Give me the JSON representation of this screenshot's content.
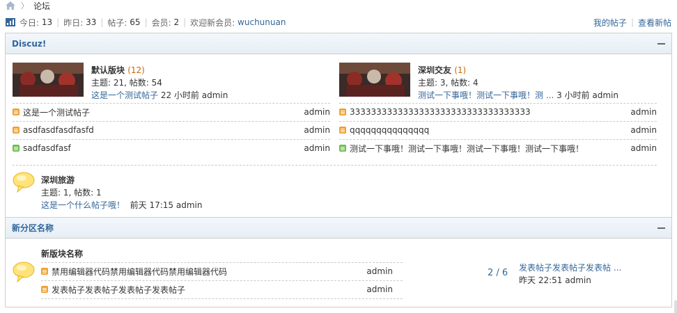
{
  "breadcrumb": {
    "icon": "home-icon",
    "separator": "〉",
    "current": "论坛"
  },
  "stats": {
    "today_label": "今日:",
    "today": "13",
    "yesterday_label": "昨日:",
    "yesterday": "33",
    "posts_label": "帖子:",
    "posts": "65",
    "members_label": "会员:",
    "members": "2",
    "newmember_label": "欢迎新会员:",
    "newmember": "wuchunuan"
  },
  "toplinks": {
    "my_posts": "我的帖子",
    "new_posts": "查看新帖"
  },
  "colors": {
    "link": "#336699",
    "orange_icon": "#f0a030",
    "green_icon": "#6bbf4a",
    "count": "#cc6600"
  },
  "sections": [
    {
      "title": "Discuz!",
      "forums": [
        {
          "name": "默认版块",
          "count": "(12)",
          "stats": "主题: 21, 帖数: 54",
          "last_title": "这是一个测试帖子",
          "last_time": "22 小时前",
          "last_author": "admin",
          "threads": [
            {
              "title": "这是一个测试帖子",
              "author": "admin",
              "icon": "orange"
            },
            {
              "title": "asdfasdfasdfasfd",
              "author": "admin",
              "icon": "orange"
            },
            {
              "title": "sadfasdfasf",
              "author": "admin",
              "icon": "green"
            }
          ]
        },
        {
          "name": "深圳交友",
          "count": "(1)",
          "stats": "主题: 3, 帖数: 4",
          "last_title": "测试一下事哦！测试一下事哦！测 ...",
          "last_time": "3 小时前",
          "last_author": "admin",
          "threads": [
            {
              "title": "3333333333333333333333333333333333",
              "author": "admin",
              "icon": "orange"
            },
            {
              "title": "qqqqqqqqqqqqqqq",
              "author": "admin",
              "icon": "orange"
            },
            {
              "title": "测试一下事哦！测试一下事哦！测试一下事哦！测试一下事哦！",
              "author": "admin",
              "icon": "green"
            }
          ]
        },
        {
          "name": "深圳旅游",
          "stats": "主题: 1, 帖数: 1",
          "last_title": "这是一个什么帖子哦！",
          "last_time": "前天 17:15",
          "last_author": "admin"
        }
      ]
    },
    {
      "title": "新分区名称",
      "forums": [
        {
          "name": "新版块名称",
          "threads": [
            {
              "title": "禁用编辑器代码禁用编辑器代码禁用编辑器代码",
              "author": "admin",
              "icon": "orange"
            },
            {
              "title": "发表帖子发表帖子发表帖子发表帖子",
              "author": "admin",
              "icon": "orange"
            }
          ],
          "counts": "2 / 6",
          "last_title": "发表帖子发表帖子发表帖 ...",
          "last_time": "昨天 22:51",
          "last_author": "admin"
        }
      ]
    }
  ]
}
